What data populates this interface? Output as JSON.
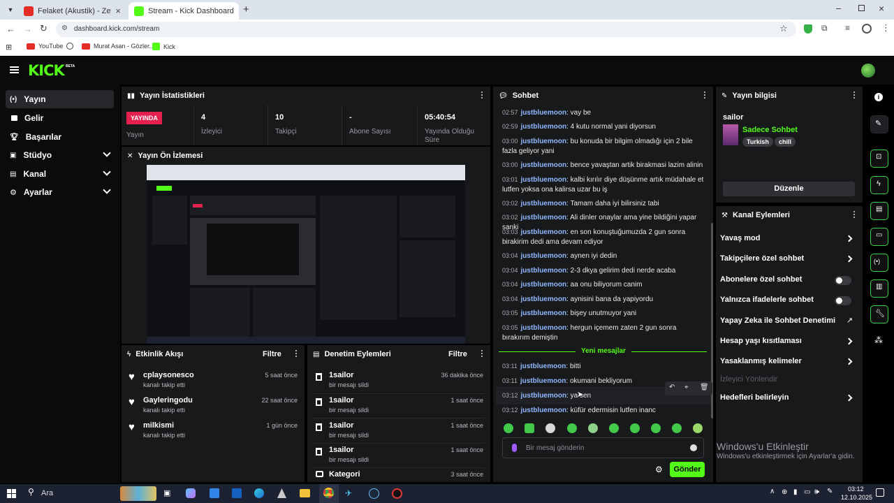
{
  "browser": {
    "tabs": [
      {
        "title": "Felaket (Akustik) - Zeynep B"
      },
      {
        "title": "Stream - Kick Dashboard"
      }
    ],
    "url": "dashboard.kick.com/stream",
    "bookmarks": [
      "YouTube",
      "Murat Asan - Gözler...",
      "Kick"
    ]
  },
  "header": {
    "logo": "KICK",
    "beta": "BETA"
  },
  "sidebar": {
    "items": [
      {
        "label": "Yayın",
        "icon": "broadcast-icon"
      },
      {
        "label": "Gelir",
        "icon": "money-icon"
      },
      {
        "label": "Başarılar",
        "icon": "trophy-icon"
      },
      {
        "label": "Stüdyo",
        "icon": "studio-icon"
      },
      {
        "label": "Kanal",
        "icon": "channel-icon"
      },
      {
        "label": "Ayarlar",
        "icon": "gear-icon"
      }
    ]
  },
  "stats": {
    "title": "Yayın İstatistikleri",
    "live_badge": "YAYINDA",
    "live_label": "Yayın",
    "items": [
      {
        "value": "4",
        "label": "İzleyici"
      },
      {
        "value": "10",
        "label": "Takipçi"
      },
      {
        "value": "-",
        "label": "Abone Sayısı"
      },
      {
        "value": "05:40:54",
        "label": "Yayında Olduğu Süre"
      }
    ]
  },
  "preview": {
    "title": "Yayın Ön İzlemesi"
  },
  "activity": {
    "title": "Etkinlik Akışı",
    "filter": "Filtre",
    "items": [
      {
        "name": "cplaysonesco",
        "desc": "kanalı takip etti",
        "time": "5 saat önce"
      },
      {
        "name": "Gayleringodu",
        "desc": "kanalı takip etti",
        "time": "22 saat önce"
      },
      {
        "name": "milkismi",
        "desc": "kanalı takip etti",
        "time": "1 gün önce"
      }
    ]
  },
  "moderation": {
    "title": "Denetim Eylemleri",
    "filter": "Filtre",
    "items": [
      {
        "name": "1sailor",
        "desc": "bir mesajı sildi",
        "time": "36 dakika önce"
      },
      {
        "name": "1sailor",
        "desc": "bir mesajı sildi",
        "time": "1 saat önce"
      },
      {
        "name": "1sailor",
        "desc": "bir mesajı sildi",
        "time": "1 saat önce"
      },
      {
        "name": "1sailor",
        "desc": "bir mesajı sildi",
        "time": "1 saat önce"
      },
      {
        "name": "Kategori",
        "desc": "",
        "time": "3 saat önce"
      }
    ]
  },
  "chat": {
    "title": "Sohbet",
    "new_messages": "Yeni mesajlar",
    "placeholder": "Bir mesaj gönderin",
    "send": "Gönder",
    "messages": [
      {
        "time": "02:57",
        "user": "justbluemoon",
        "text": ": vay be"
      },
      {
        "time": "02:59",
        "user": "justbluemoon",
        "text": ": 4 kutu normal yani diyorsun"
      },
      {
        "time": "03:00",
        "user": "justbluemoon",
        "text": ": bu konuda bir bilgim olmadığı için 2 bile fazla geliyor yani"
      },
      {
        "time": "03:00",
        "user": "justbluemoon",
        "text": ": bence yavaştan artik birakmasi lazim alinin"
      },
      {
        "time": "03:01",
        "user": "justbluemoon",
        "text": ": kalbi kırılır diye düşünme artık müdahale et lutfen yoksa ona kalirsa uzar bu iş"
      },
      {
        "time": "03:02",
        "user": "justbluemoon",
        "text": ": Tamam daha iyi bilirsiniz tabi"
      },
      {
        "time": "03:02",
        "user": "justbluemoon",
        "text": ": Ali dinler onaylar ama yine bildiğini yapar sanki"
      },
      {
        "time": "03:03",
        "user": "justbluemoon",
        "text": ": en son konuştuğumuzda 2 gun sonra birakirim dedi ama devam ediyor"
      },
      {
        "time": "03:04",
        "user": "justbluemoon",
        "text": ": aynen iyi dedin"
      },
      {
        "time": "03:04",
        "user": "justbluemoon",
        "text": ": 2-3 dkya gelirim dedi nerde acaba"
      },
      {
        "time": "03:04",
        "user": "justbluemoon",
        "text": ": aa onu biliyorum canim"
      },
      {
        "time": "03:04",
        "user": "justbluemoon",
        "text": ": aynisini bana da yapiyordu"
      },
      {
        "time": "03:05",
        "user": "justbluemoon",
        "text": ": bişey unutmuyor yani"
      },
      {
        "time": "03:05",
        "user": "justbluemoon",
        "text": ": hergun içemem zaten 2 gun sonra bırakırım demiştin"
      },
      {
        "time": "03:11",
        "user": "justbluemoon",
        "text": ": bitti"
      },
      {
        "time": "03:11",
        "user": "justbluemoon",
        "text": ": okumani bekliyorum"
      },
      {
        "time": "03:12",
        "user": "justbluemoon",
        "text": ": ya sen"
      },
      {
        "time": "03:12",
        "user": "justbluemoon",
        "text": ": küfür edermisin lutfen inanc"
      }
    ]
  },
  "info": {
    "title": "Yayın bilgisi",
    "stream_title": "sailor",
    "category": "Sadece Sohbet",
    "tags": [
      "Turkish",
      "chill"
    ],
    "edit": "Düzenle"
  },
  "actions": {
    "title": "Kanal Eylemleri",
    "items": [
      {
        "label": "Yavaş mod",
        "kind": "arrow"
      },
      {
        "label": "Takipçilere özel sohbet",
        "kind": "arrow"
      },
      {
        "label": "Abonelere özel sohbet",
        "kind": "toggle",
        "on": false
      },
      {
        "label": "Yalnızca ifadelerle sohbet",
        "kind": "toggle",
        "on": false
      },
      {
        "label": "Yapay Zeka ile Sohbet Denetimi",
        "kind": "external"
      },
      {
        "label": "Hesap yaşı kısıtlaması",
        "kind": "arrow"
      },
      {
        "label": "Yasaklanmış kelimeler",
        "kind": "arrow"
      },
      {
        "label": "İzleyici Yönlendir",
        "kind": "disabled"
      },
      {
        "label": "Hedefleri belirleyin",
        "kind": "arrow"
      }
    ]
  },
  "watermark": {
    "title": "Windows'u Etkinleştir",
    "sub": "Windows'u etkinleştirmek için Ayarlar'a gidin."
  },
  "taskbar": {
    "search": "Ara",
    "time": "03:12",
    "date": "12.10.2025"
  }
}
